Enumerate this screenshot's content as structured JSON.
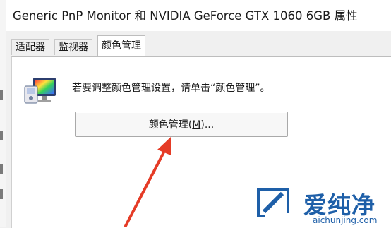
{
  "window": {
    "title": "Generic PnP Monitor 和 NVIDIA GeForce GTX 1060 6GB 属性"
  },
  "tabs": [
    {
      "label": "适配器",
      "active": false
    },
    {
      "label": "监视器",
      "active": false
    },
    {
      "label": "颜色管理",
      "active": true
    }
  ],
  "color_management": {
    "instruction": "若要调整颜色管理设置，请单击“颜色管理”。",
    "button": {
      "text_before": "颜色管理(",
      "accelerator": "M",
      "text_after": ")..."
    }
  },
  "watermark": {
    "name": "爱纯净",
    "url": "aichunjing.com"
  },
  "colors": {
    "arrow": "#e53b26",
    "watermark": "#1e5fa8"
  },
  "icons": {
    "display": "monitor-color-icon",
    "annotation": "red-arrow",
    "logo": "aichunjing-logo"
  }
}
